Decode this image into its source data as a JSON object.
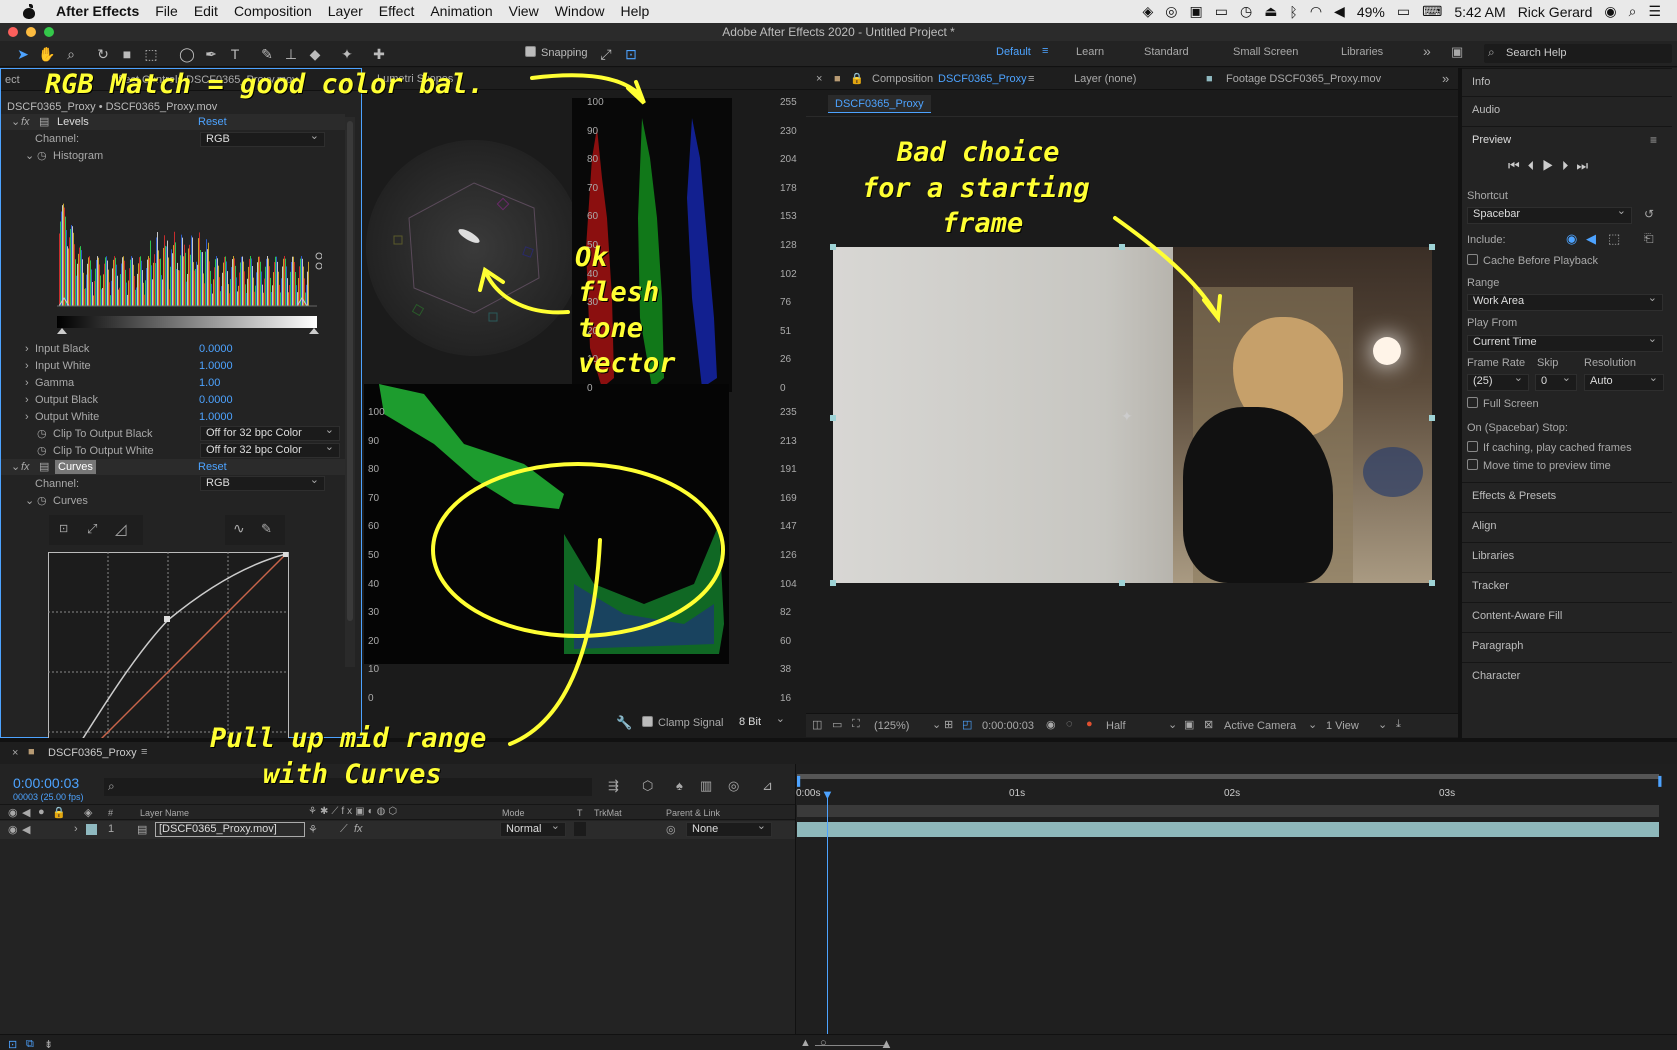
{
  "menubar": {
    "app": "After Effects",
    "items": [
      "File",
      "Edit",
      "Composition",
      "Layer",
      "Effect",
      "Animation",
      "View",
      "Window",
      "Help"
    ],
    "battery": "49%",
    "time": "5:42 AM",
    "user": "Rick Gerard"
  },
  "titlebar": {
    "title": "Adobe After Effects 2020 - Untitled Project *"
  },
  "toolbar": {
    "snapping": "Snapping",
    "workspaces": [
      "Default",
      "Learn",
      "Standard",
      "Small Screen",
      "Libraries"
    ],
    "search_placeholder": "Search Help"
  },
  "effect_controls": {
    "tab_left": "ect",
    "tab_label": "Effect Controls DSCF0365_Proxy.mov",
    "scopes_tab": "Lumetri Scopes",
    "breadcrumb": "DSCF0365_Proxy • DSCF0365_Proxy.mov",
    "levels": {
      "name": "Levels",
      "reset": "Reset",
      "channel_label": "Channel:",
      "channel": "RGB",
      "histogram": "Histogram",
      "params": [
        {
          "label": "Input Black",
          "value": "0.0000"
        },
        {
          "label": "Input White",
          "value": "1.0000"
        },
        {
          "label": "Gamma",
          "value": "1.00"
        },
        {
          "label": "Output Black",
          "value": "0.0000"
        },
        {
          "label": "Output White",
          "value": "1.0000"
        }
      ],
      "clip_black_label": "Clip To Output Black",
      "clip_black": "Off for 32 bpc Color",
      "clip_white_label": "Clip To Output White",
      "clip_white": "Off for 32 bpc Color"
    },
    "curves": {
      "name": "Curves",
      "reset": "Reset",
      "channel_label": "Channel:",
      "channel": "RGB",
      "label": "Curves"
    }
  },
  "scopes": {
    "parade_left": [
      "100",
      "90",
      "80",
      "70",
      "60",
      "50",
      "40",
      "30",
      "20",
      "10",
      "0"
    ],
    "parade_right": [
      "255",
      "230",
      "204",
      "178",
      "153",
      "128",
      "102",
      "76",
      "51",
      "26",
      "0"
    ],
    "wave_left": [
      "100",
      "90",
      "80",
      "70",
      "60",
      "50",
      "40",
      "30",
      "20",
      "10",
      "0"
    ],
    "wave_right": [
      "235",
      "213",
      "191",
      "169",
      "147",
      "126",
      "104",
      "82",
      "60",
      "38",
      "16"
    ],
    "clamp": "Clamp Signal",
    "bits": "8 Bit"
  },
  "composition": {
    "tab": "Composition",
    "comp_name": "DSCF0365_Proxy",
    "layer_tab": "Layer (none)",
    "footage_tab": "Footage DSCF0365_Proxy.mov",
    "subtab": "DSCF0365_Proxy",
    "zoom": "(125%)",
    "timecode": "0:00:00:03",
    "resolution": "Half",
    "camera": "Active Camera",
    "views": "1 View"
  },
  "right_panel": {
    "info": "Info",
    "audio": "Audio",
    "preview": "Preview",
    "shortcut_label": "Shortcut",
    "shortcut": "Spacebar",
    "include_label": "Include:",
    "cache_before": "Cache Before Playback",
    "range_label": "Range",
    "range": "Work Area",
    "play_from_label": "Play From",
    "play_from": "Current Time",
    "frame_rate_label": "Frame Rate",
    "skip_label": "Skip",
    "resolution_label": "Resolution",
    "frame_rate": "(25)",
    "skip": "0",
    "resolution": "Auto",
    "full_screen": "Full Screen",
    "stop_label": "On (Spacebar) Stop:",
    "if_caching": "If caching, play cached frames",
    "move_time": "Move time to preview time",
    "panels": [
      "Effects & Presets",
      "Align",
      "Libraries",
      "Tracker",
      "Content-Aware Fill",
      "Paragraph",
      "Character"
    ]
  },
  "timeline": {
    "tab": "DSCF0365_Proxy",
    "timecode": "0:00:00:03",
    "frames": "00003 (25.00 fps)",
    "col_layer": "Layer Name",
    "col_mode": "Mode",
    "col_t": "T",
    "col_trkmat": "TrkMat",
    "col_parent": "Parent & Link",
    "layer": {
      "num": "1",
      "name": "[DSCF0365_Proxy.mov]",
      "mode": "Normal",
      "parent": "None"
    },
    "ruler": [
      "0:00s",
      "01s",
      "02s",
      "03s"
    ]
  },
  "annotations": {
    "rgb": "RGB Match = good color bal.",
    "bad1": "Bad choice",
    "bad2": "for a starting",
    "bad3": "frame",
    "ok1": "Ok",
    "ok2": "flesh",
    "ok3": "tone",
    "ok4": "vector",
    "pull1": "Pull up mid range",
    "pull2": "with Curves"
  },
  "colors": {
    "accent": "#4da3ff",
    "annotation": "#ffff33",
    "curve_white": "#cccccc",
    "curve_red": "#c8644a"
  }
}
